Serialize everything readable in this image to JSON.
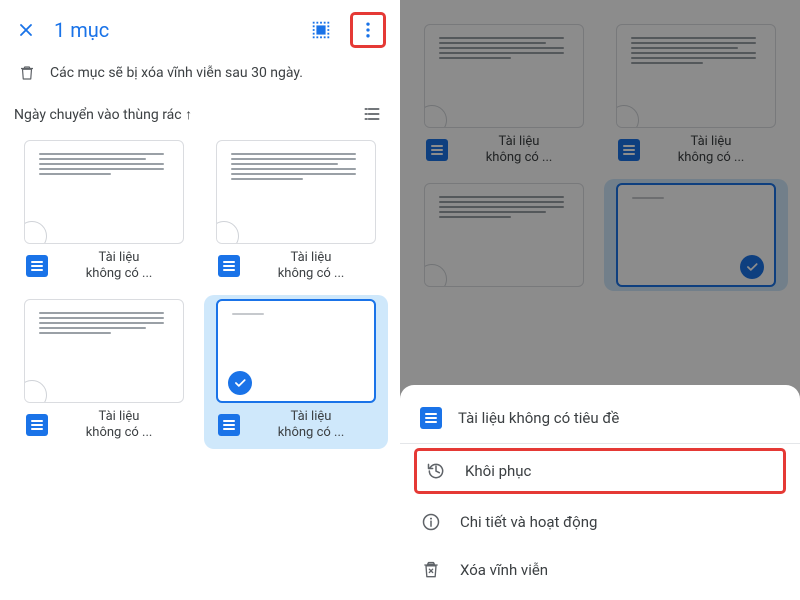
{
  "left": {
    "title": "1 mục",
    "info": "Các mục sẽ bị xóa vĩnh viễn sau 30 ngày.",
    "sort": "Ngày chuyển vào thùng rác ↑",
    "item_label": "Tài liệu\nkhông có ..."
  },
  "right": {
    "item_label": "Tài liệu\nkhông có ...",
    "sheet_title": "Tài liệu không có tiêu đề",
    "restore": "Khôi phục",
    "details": "Chi tiết và hoạt động",
    "delete": "Xóa vĩnh viễn"
  }
}
